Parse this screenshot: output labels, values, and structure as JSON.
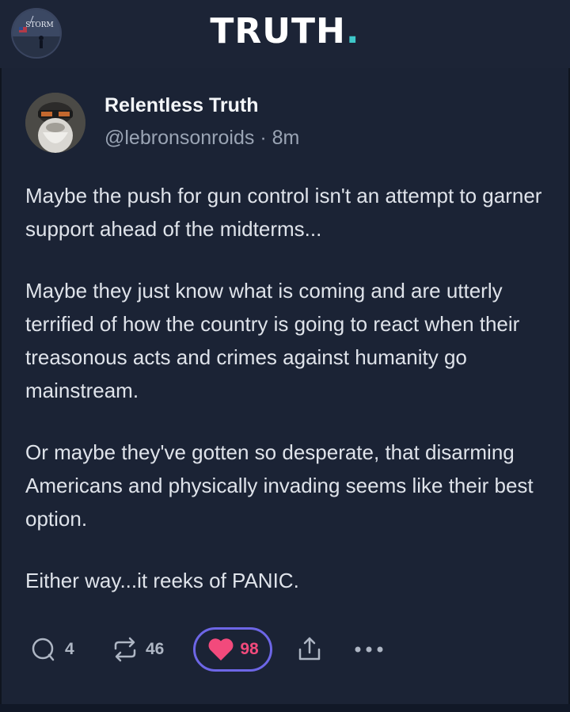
{
  "header": {
    "logo_text": "TRUTH",
    "logo_dot": ".",
    "channel_avatar_text": "STORM",
    "accent_color": "#3ec7c9"
  },
  "post": {
    "author_name": "Relentless Truth",
    "author_handle": "@lebronsonroids",
    "separator": "·",
    "timestamp": "8m",
    "paragraphs": [
      "Maybe the push for gun control isn't an attempt to garner support ahead of the midterms...",
      "Maybe they just know what is coming and are utterly terrified of how the country is going to react when their treasonous acts and crimes against humanity go mainstream.",
      "Or maybe they've gotten so desperate, that disarming Americans and physically invading seems like their best option.",
      "Either way...it reeks of PANIC."
    ]
  },
  "actions": {
    "reply_icon": "reply-icon",
    "reply_count": "4",
    "repost_icon": "repost-icon",
    "repost_count": "46",
    "like_icon": "heart-icon",
    "like_count": "98",
    "like_color": "#f24a7c",
    "share_icon": "share-icon",
    "more_icon": "more-icon"
  }
}
